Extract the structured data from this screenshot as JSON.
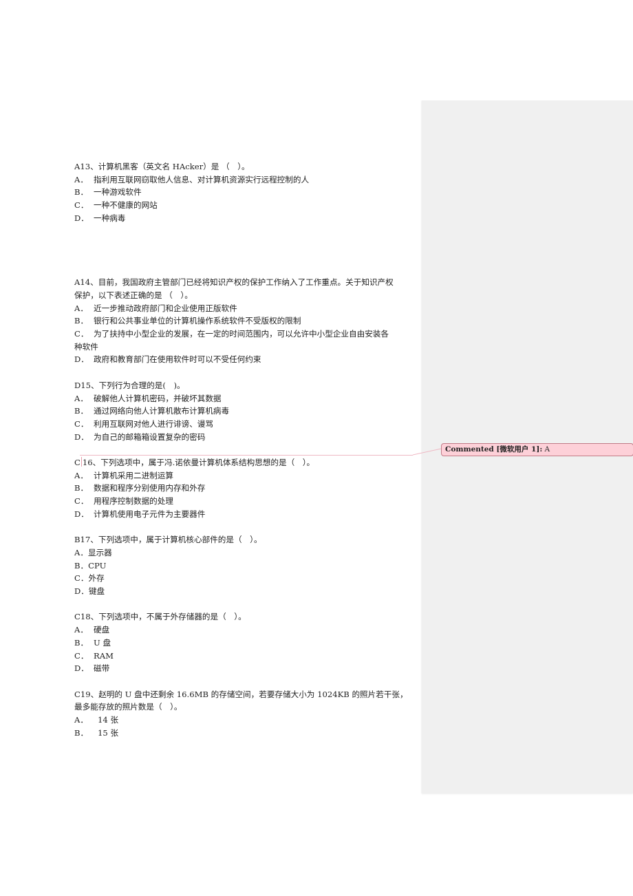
{
  "document": {
    "questions": [
      {
        "id": "A13",
        "stem": "A13、计算机黑客（英文名 HAcker）是 （　）。",
        "options": [
          {
            "letter": "A．",
            "text": "指利用互联网窃取他人信息、对计算机资源实行远程控制的人"
          },
          {
            "letter": "B．",
            "text": "一种游戏软件"
          },
          {
            "letter": "C．",
            "text": "一种不健康的网站"
          },
          {
            "letter": "D．",
            "text": "一种病毒"
          }
        ]
      },
      {
        "id": "A14",
        "stem_line1": "A14、目前，我国政府主管部门已经将知识产权的保护工作纳入了工作重点。关于知识产权",
        "stem_line2": "保护，以下表述正确的是 （　）。",
        "options": [
          {
            "letter": "A．",
            "text": "近一步推动政府部门和企业使用正版软件"
          },
          {
            "letter": "B．",
            "text": "银行和公共事业单位的计算机操作系统软件不受版权的限制"
          },
          {
            "letter": "C．",
            "text_line1": "为了扶持中小型企业的发展，在一定的时间范围内，可以允许中小型企业自由安装各",
            "text_line2": "种软件"
          },
          {
            "letter": "D．",
            "text": "政府和教育部门在使用软件时可以不受任何约束"
          }
        ]
      },
      {
        "id": "D15",
        "stem": "D15、下列行为合理的是(　)。",
        "options": [
          {
            "letter": "A．",
            "text": "破解他人计算机密码，并破坏其数据"
          },
          {
            "letter": "B．",
            "text": "通过网络向他人计算机散布计算机病毒"
          },
          {
            "letter": "C．",
            "text": "利用互联网对他人进行诽谤、谩骂"
          },
          {
            "letter": "D．",
            "text": "为自己的邮箱箱设置复杂的密码"
          }
        ]
      },
      {
        "id": "C16",
        "stem_prefix": "C",
        "stem_rest": "16、下列选项中，属于冯.诺依曼计算机体系结构思想的是（　）。",
        "options": [
          {
            "letter": "A．",
            "text": "计算机采用二进制运算"
          },
          {
            "letter": "B．",
            "text": "数据和程序分别使用内存和外存"
          },
          {
            "letter": "C．",
            "text": "用程序控制数据的处理"
          },
          {
            "letter": "D．",
            "text": "计算机使用电子元件为主要器件"
          }
        ]
      },
      {
        "id": "B17",
        "stem": "B17、下列选项中，属于计算机核心部件的是（　）。",
        "options": [
          {
            "letter": "A．",
            "text": "显示器"
          },
          {
            "letter": "B．",
            "text": "CPU"
          },
          {
            "letter": "C．",
            "text": "外存"
          },
          {
            "letter": "D．",
            "text": "键盘"
          }
        ]
      },
      {
        "id": "C18",
        "stem": "C18、下列选项中，不属于外存储器的是（　）。",
        "options": [
          {
            "letter": "A．",
            "text": "硬盘"
          },
          {
            "letter": "B．",
            "text": "U 盘"
          },
          {
            "letter": "C．",
            "text": "RAM"
          },
          {
            "letter": "D．",
            "text": "磁带"
          }
        ]
      },
      {
        "id": "C19",
        "stem_line1": "C19、赵明的 U 盘中还剩余 16.6MB 的存储空间，若要存储大小为 1024KB 的照片若干张，",
        "stem_line2": "最多能存放的照片数是（　）。",
        "options": [
          {
            "letter": "A．",
            "text": "14 张"
          },
          {
            "letter": "B．",
            "text": "15 张"
          }
        ]
      }
    ]
  },
  "comment": {
    "label": "Commented [微软用户 1]:",
    "text": "A",
    "colors": {
      "fill": "#fdd0d8",
      "border": "#c07a86",
      "connector": "#efb8c3",
      "pane": "#f0f0f0"
    }
  }
}
